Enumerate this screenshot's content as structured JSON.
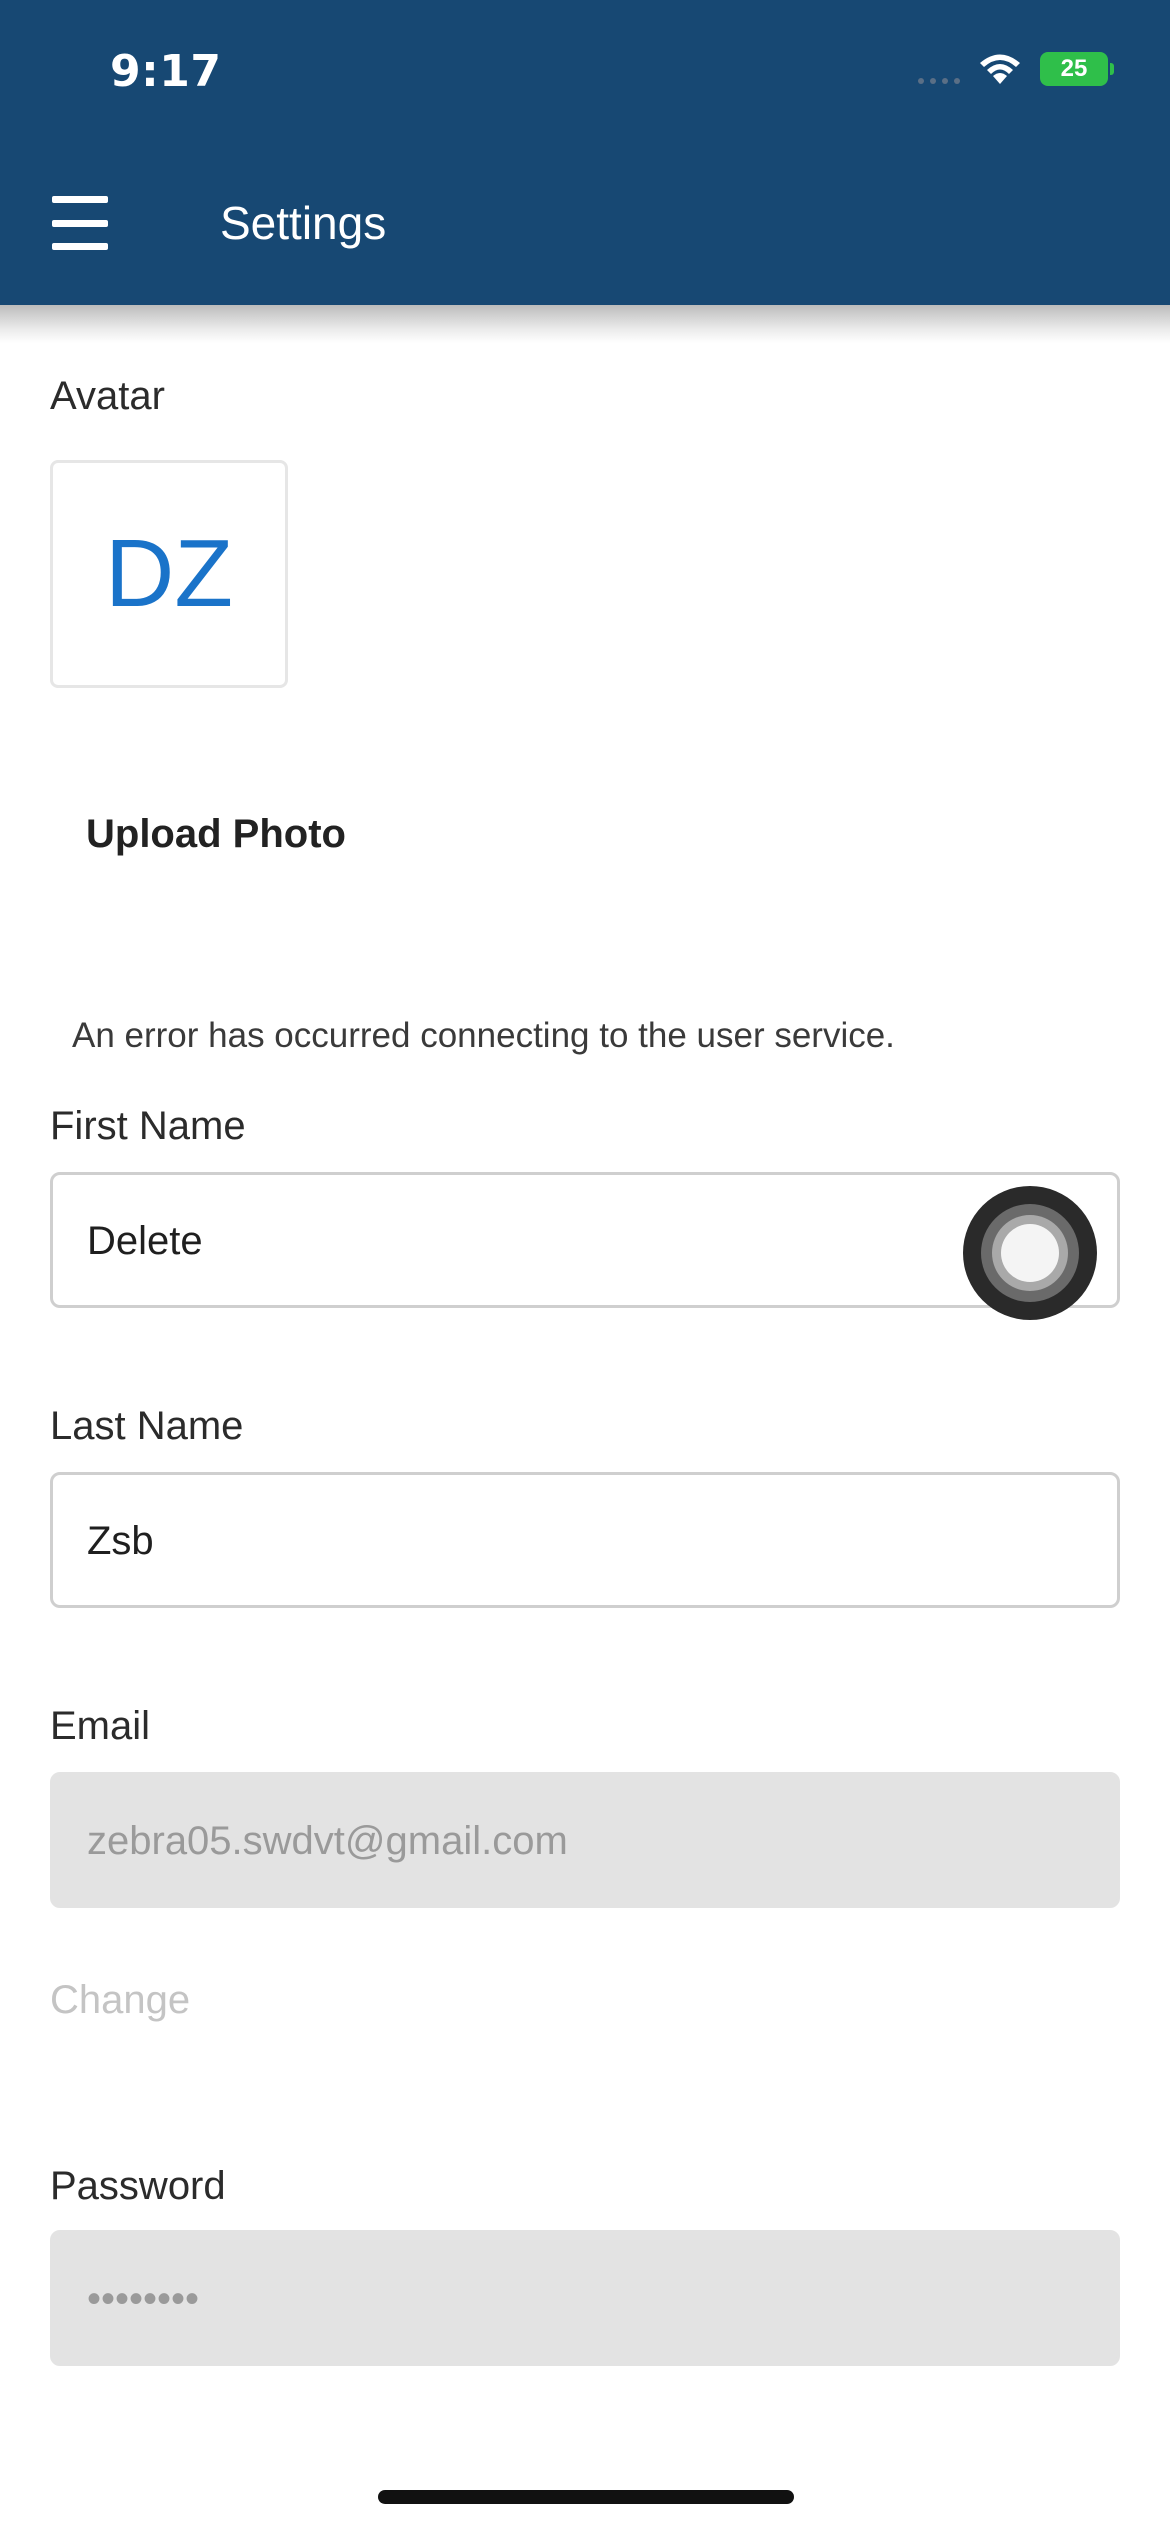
{
  "status_bar": {
    "time": "9:17",
    "battery": "25"
  },
  "header": {
    "title": "Settings",
    "menu_icon": "hamburger-menu-icon"
  },
  "avatar": {
    "label": "Avatar",
    "initials": "DZ",
    "upload_label": "Upload Photo"
  },
  "error_message": "An error has occurred connecting to the user service.",
  "form": {
    "first_name": {
      "label": "First Name",
      "value": "Delete"
    },
    "last_name": {
      "label": "Last Name",
      "value": "Zsb"
    },
    "email": {
      "label": "Email",
      "value": "zebra05.swdvt@gmail.com",
      "change_label": "Change"
    },
    "password": {
      "label": "Password",
      "value": "••••••••"
    }
  },
  "colors": {
    "header_bg": "#174873",
    "avatar_initials": "#1a73c9",
    "battery": "#2fbf4a"
  }
}
